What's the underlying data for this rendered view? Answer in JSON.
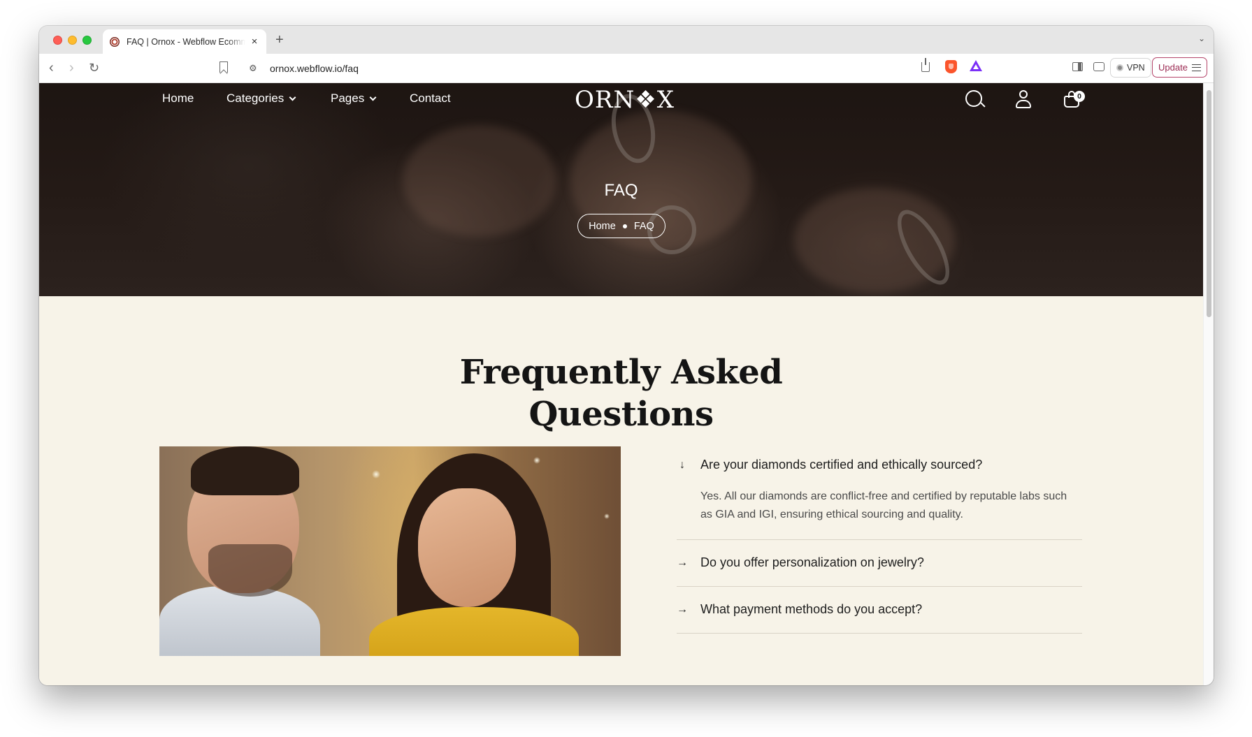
{
  "browser": {
    "tab_title": "FAQ | Ornox - Webflow Ecommerce",
    "tab_close": "×",
    "new_tab": "+",
    "url": "ornox.webflow.io/faq",
    "vpn_label": "VPN",
    "update_label": "Update"
  },
  "nav": {
    "links": [
      "Home",
      "Categories",
      "Pages",
      "Contact"
    ],
    "logo": "ORN❖X",
    "cart_count": "0"
  },
  "hero": {
    "title": "FAQ",
    "breadcrumb": [
      "Home",
      "FAQ"
    ]
  },
  "faq": {
    "heading_line1": "Frequently Asked",
    "heading_line2": "Questions",
    "items": [
      {
        "question": "Are your diamonds certified and ethically sourced?",
        "answer": "Yes. All our diamonds are conflict-free and certified by reputable labs such as GIA and IGI, ensuring ethical sourcing and quality.",
        "open": true,
        "arrow": "↓"
      },
      {
        "question": "Do you offer personalization on jewelry?",
        "open": false,
        "arrow": "→"
      },
      {
        "question": "What payment methods do you accept?",
        "open": false,
        "arrow": "→"
      }
    ]
  },
  "colors": {
    "page_bg": "#f7f3e8",
    "hero_bg": "#1d1512",
    "heading": "#141414",
    "update_accent": "#9b2a52"
  }
}
